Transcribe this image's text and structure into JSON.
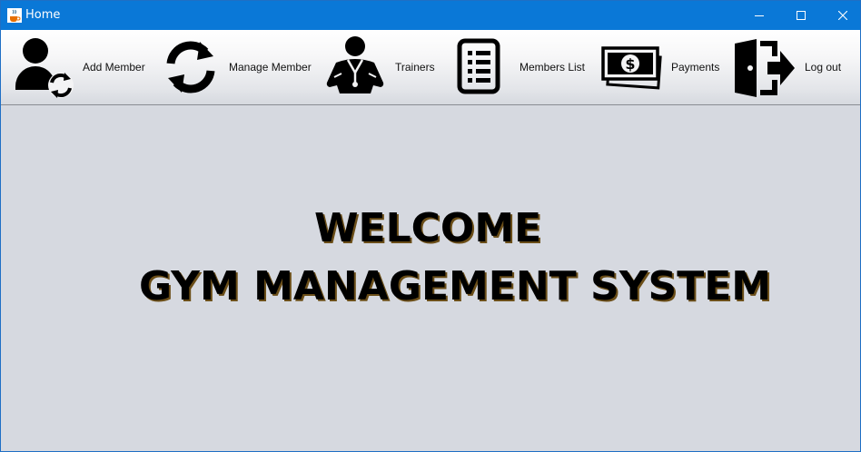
{
  "window": {
    "title": "Home",
    "app_icon": "java-coffee-icon",
    "controls": {
      "minimize": "minimize-icon",
      "maximize": "maximize-icon",
      "close": "close-icon"
    }
  },
  "toolbar": {
    "items": [
      {
        "label": "Add Member",
        "icon": "user-refresh-icon"
      },
      {
        "label": "Manage Member",
        "icon": "refresh-icon"
      },
      {
        "label": "Trainers",
        "icon": "trainer-icon"
      },
      {
        "label": "Members List",
        "icon": "list-document-icon"
      },
      {
        "label": "Payments",
        "icon": "money-icon"
      },
      {
        "label": "Log out",
        "icon": "logout-door-icon"
      }
    ]
  },
  "main": {
    "welcome": "WELCOME",
    "system_title": "GYM MANAGEMENT SYSTEM"
  },
  "colors": {
    "titlebar": "#0a78d7",
    "background": "#d6d9e0",
    "text": "#000000"
  }
}
